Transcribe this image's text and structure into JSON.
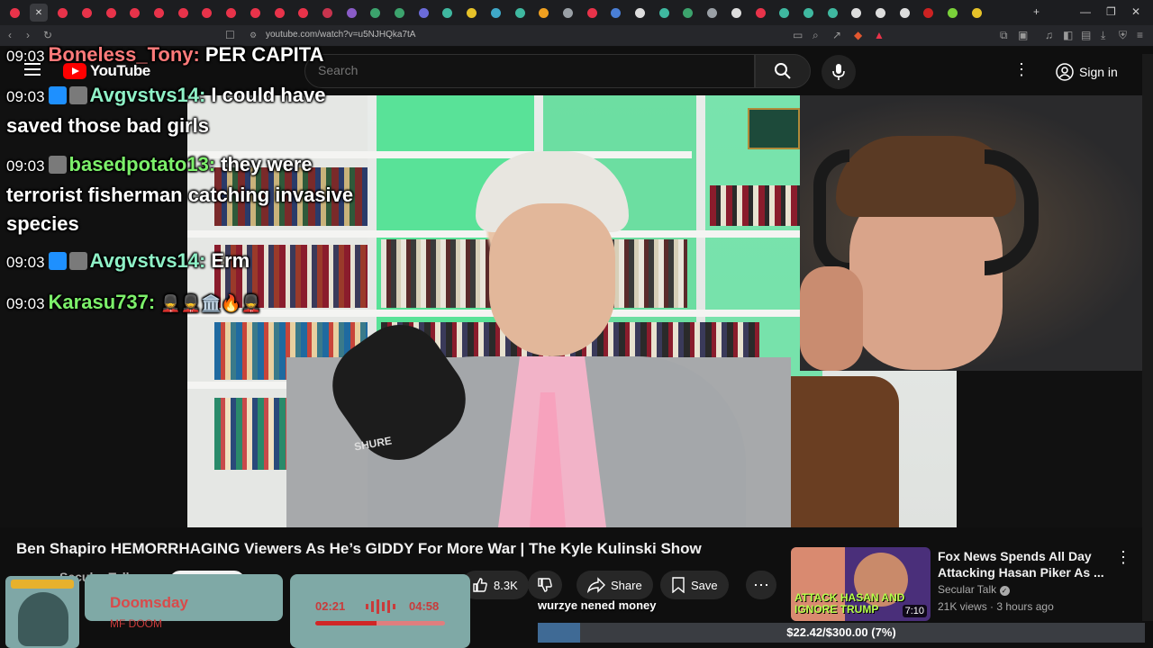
{
  "browser": {
    "url": "youtube.com/watch?v=u5NJHQka7tA",
    "tab_close": "✕",
    "new_tab": "+",
    "window_controls": [
      "—",
      "❐",
      "✕"
    ],
    "tab_colors": [
      "#e8334a",
      "#e8334a",
      "#e8334a",
      "#e8334a",
      "#e8334a",
      "#e8334a",
      "#e8334a",
      "#e8334a",
      "#e8334a",
      "#e8334a",
      "#e8334a",
      "#e8334a",
      "#e8334a",
      "#c8344e",
      "#8a5cc7",
      "#3ca36d",
      "#3ca36d",
      "#6b6bd9",
      "#3fb8a0",
      "#e6c229",
      "#3fa8c8",
      "#3fb8a0",
      "#f0a020",
      "#9aa0a6",
      "#e8334a",
      "#4a7fd6",
      "#dddddd",
      "#3fb8a0",
      "#3ca36d",
      "#9aa0a6",
      "#dddddd",
      "#e8334a",
      "#3fb8a0",
      "#3fb8a0",
      "#3fb8a0",
      "#dddddd",
      "#dddddd",
      "#dddddd",
      "#cc2222",
      "#7ad13a",
      "#e6c229"
    ]
  },
  "header": {
    "logo_text": "YouTube",
    "search_placeholder": "Search",
    "signin_label": "Sign in"
  },
  "chat": [
    {
      "time": "09:03",
      "user": "Boneless_Tony:",
      "user_color": "#ff7a7a",
      "text": "PER CAPITA",
      "badges": []
    },
    {
      "time": "09:03",
      "user": "Avgvstvs14:",
      "user_color": "#8ef0c6",
      "text": "I could have saved those bad girls",
      "badges": [
        "#1e90ff",
        "#7a7a7a"
      ]
    },
    {
      "time": "09:03",
      "user": "basedpotato13:",
      "user_color": "#7cf06a",
      "text": "they were terrorist fisherman catching invasive species",
      "badges": [
        "#7a7a7a"
      ]
    },
    {
      "time": "09:03",
      "user": "Avgvstvs14:",
      "user_color": "#8ef0c6",
      "text": "Erm",
      "badges": [
        "#1e90ff",
        "#7a7a7a"
      ]
    },
    {
      "time": "09:03",
      "user": "Karasu737:",
      "user_color": "#7cf06a",
      "text": "💂💂🏛️🔥💂",
      "badges": []
    }
  ],
  "video": {
    "title": "Ben Shapiro HEMORRHAGING Viewers As He’s GIDDY For More War | The Kyle Kulinski Show",
    "channel": "Secular Talk",
    "likes": "8.3K",
    "share_label": "Share",
    "save_label": "Save"
  },
  "music_widget": {
    "song_title": "Doomsday",
    "artist": "MF DOOM",
    "current_time": "02:21",
    "total_time": "04:58",
    "progress_fraction": 0.47
  },
  "caption": "wurzye nened money",
  "goal": {
    "text": "$22.42/$300.00 (7%)",
    "fraction": 0.07
  },
  "recommendation": {
    "title": "Fox News Spends All Day Attacking Hasan Piker As ...",
    "channel": "Secular Talk",
    "meta": "21K views · 3 hours ago",
    "duration": "7:10",
    "thumb_text": "ATTACK HASAN AND IGNORE TRUMP"
  }
}
